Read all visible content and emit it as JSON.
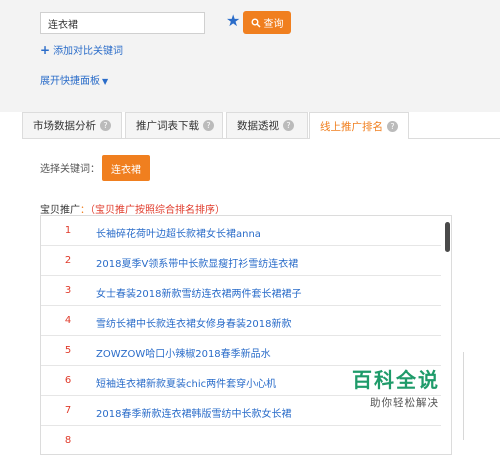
{
  "search": {
    "value": "连衣裙",
    "button_label": "查询"
  },
  "links": {
    "add_compare": "添加对比关键词",
    "expand_panel": "展开快捷面板"
  },
  "tabs": [
    {
      "label": "市场数据分析",
      "help": "?"
    },
    {
      "label": "推广词表下载",
      "help": "?"
    },
    {
      "label": "数据透视",
      "help": "?"
    },
    {
      "label": "线上推广排名",
      "help": "?"
    }
  ],
  "keyword_select": {
    "label": "选择关键词：",
    "selected": "连衣裙"
  },
  "promotion": {
    "label": "宝贝推广",
    "colon": "：",
    "note": "（宝贝推广按照综合排名排序）"
  },
  "items": [
    {
      "rank": "1",
      "title": "长袖碎花荷叶边超长款裙女长裙anna"
    },
    {
      "rank": "2",
      "title": "2018夏季V领系带中长款显瘦打衫雪纺连衣裙"
    },
    {
      "rank": "3",
      "title": "女士春装2018新款雪纺连衣裙两件套长裙裙子"
    },
    {
      "rank": "4",
      "title": "雪纺长裙中长款连衣裙女修身春装2018新款"
    },
    {
      "rank": "5",
      "title": "ZOWZOW哈口小辣椒2018春季新品水"
    },
    {
      "rank": "6",
      "title": "短袖连衣裙新款夏装chic两件套穿小心机"
    },
    {
      "rank": "7",
      "title": "2018春季新款连衣裙韩版雪纺中长款女长裙"
    },
    {
      "rank": "8",
      "title": ""
    }
  ],
  "watermark": {
    "main": "百科全说",
    "sub": "助你轻松解决"
  },
  "colors": {
    "accent": "#f07f1f",
    "link": "#2a6cc9",
    "rank": "#e03a2a",
    "brand_green": "#1f9b6a"
  }
}
